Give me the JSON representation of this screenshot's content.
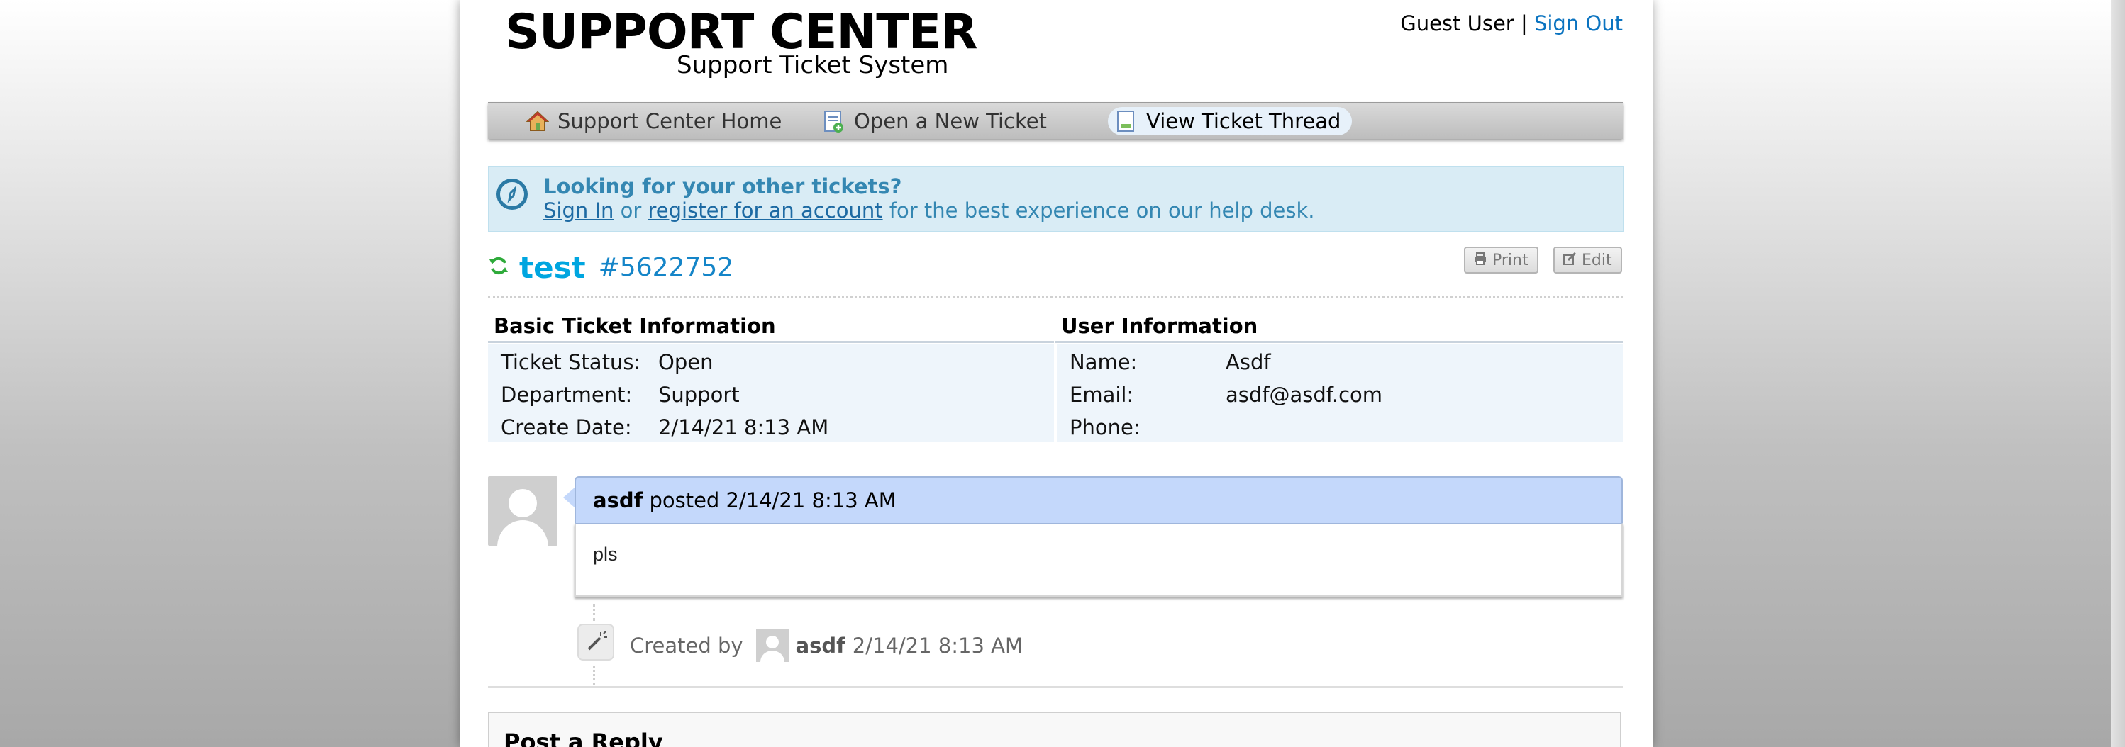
{
  "header": {
    "title": "SUPPORT CENTER",
    "subtitle": "Support Ticket System",
    "user_label": "Guest User",
    "separator": "|",
    "sign_out": "Sign Out"
  },
  "nav": {
    "items": [
      {
        "label": "Support Center Home",
        "icon": "home-icon"
      },
      {
        "label": "Open a New Ticket",
        "icon": "new-ticket-icon"
      },
      {
        "label": "View Ticket Thread",
        "icon": "ticket-thread-icon",
        "active": true
      }
    ]
  },
  "notice": {
    "title": "Looking for your other tickets?",
    "sign_in": "Sign In",
    "or": "or",
    "register": "register for an account",
    "tail": "for the best experience on our help desk."
  },
  "ticket": {
    "subject": "test",
    "number": "#5622752",
    "print_label": "Print",
    "edit_label": "Edit"
  },
  "basic_info": {
    "heading": "Basic Ticket Information",
    "rows": [
      {
        "label": "Ticket Status:",
        "value": "Open"
      },
      {
        "label": "Department:",
        "value": "Support"
      },
      {
        "label": "Create Date:",
        "value": "2/14/21 8:13 AM"
      }
    ]
  },
  "user_info": {
    "heading": "User Information",
    "rows": [
      {
        "label": "Name:",
        "value": "Asdf"
      },
      {
        "label": "Email:",
        "value": "asdf@asdf.com"
      },
      {
        "label": "Phone:",
        "value": ""
      }
    ]
  },
  "thread": {
    "author": "asdf",
    "posted": "posted 2/14/21 8:13 AM",
    "body": "pls",
    "event_prefix": "Created by",
    "event_author": "asdf",
    "event_time": "2/14/21 8:13 AM"
  },
  "reply": {
    "title": "Post a Reply"
  },
  "colors": {
    "accent": "#0a73c0",
    "subject": "#00a6e0",
    "notice_bg": "#d9ecf5",
    "message_header_bg": "#c4d8fb",
    "info_bg": "#eef5fb"
  }
}
